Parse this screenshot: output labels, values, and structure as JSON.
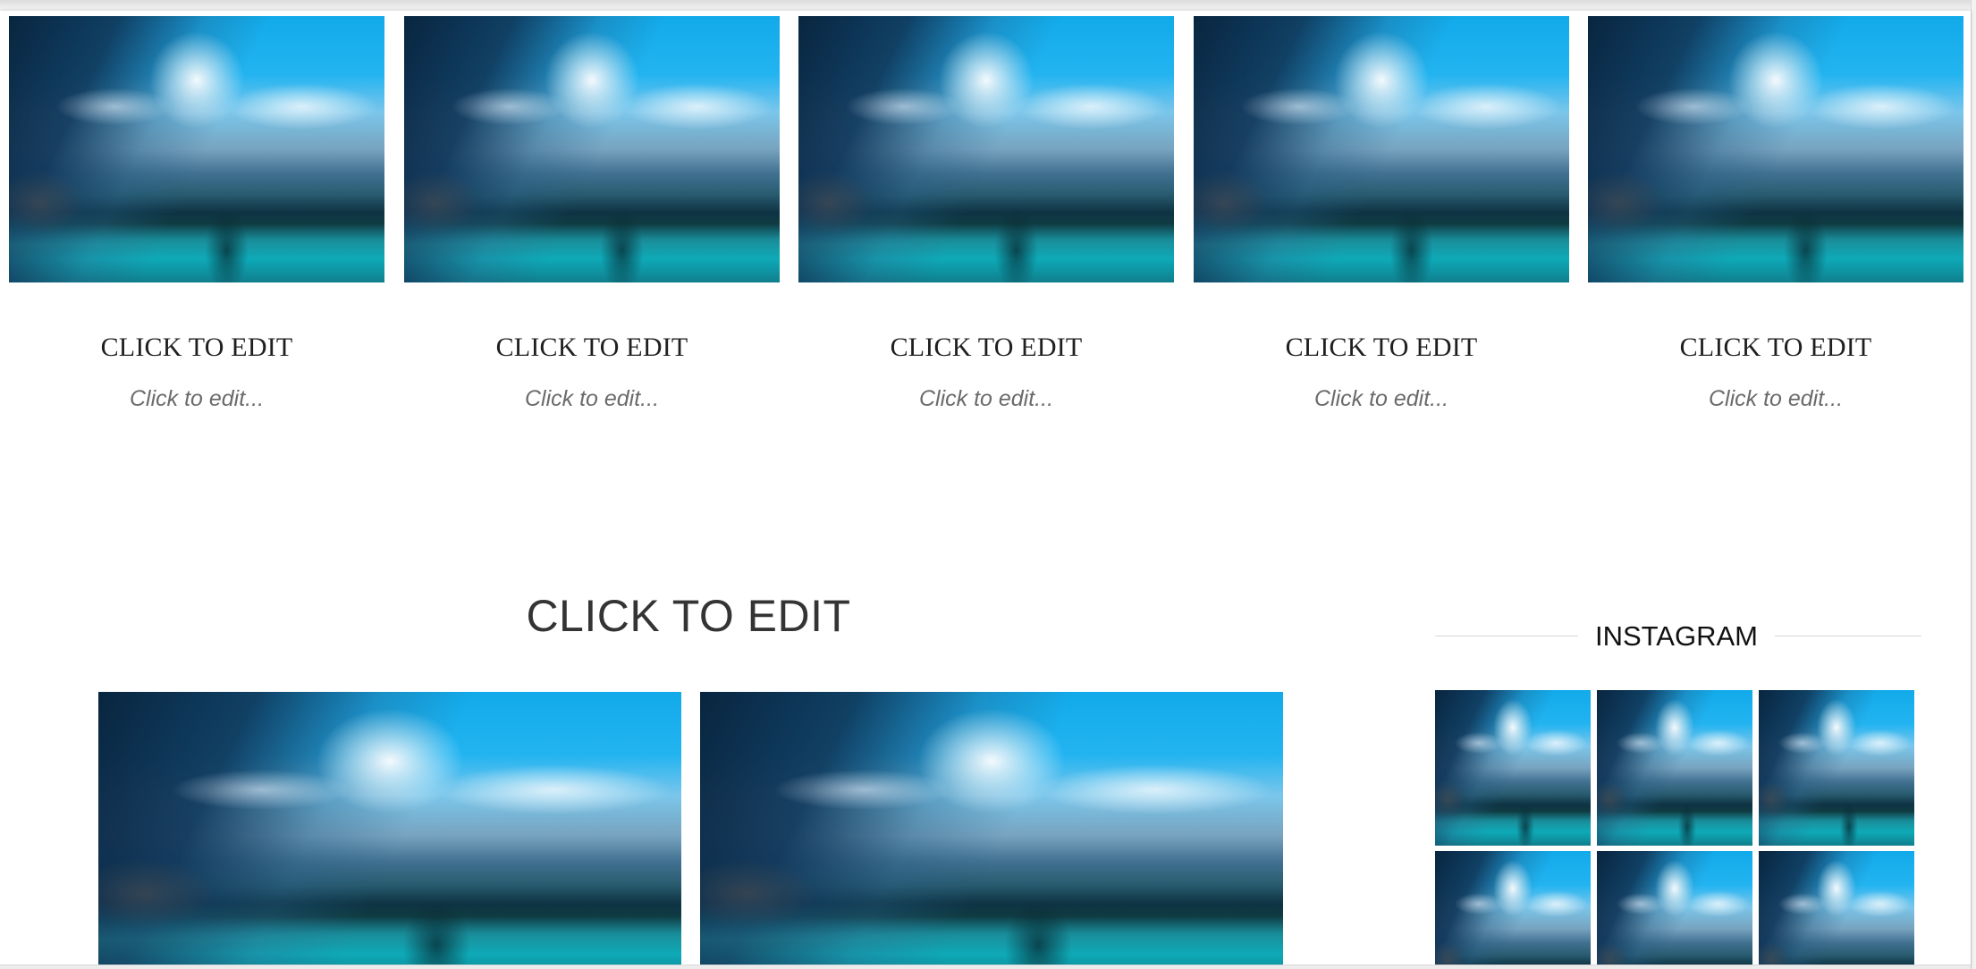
{
  "top_gallery": {
    "cards": [
      {
        "title": "CLICK TO EDIT",
        "subtitle": "Click to edit...",
        "image": "blurred-mountain-lake-photo"
      },
      {
        "title": "CLICK TO EDIT",
        "subtitle": "Click to edit...",
        "image": "blurred-mountain-lake-photo"
      },
      {
        "title": "CLICK TO EDIT",
        "subtitle": "Click to edit...",
        "image": "blurred-mountain-lake-photo"
      },
      {
        "title": "CLICK TO EDIT",
        "subtitle": "Click to edit...",
        "image": "blurred-mountain-lake-photo"
      },
      {
        "title": "CLICK TO EDIT",
        "subtitle": "Click to edit...",
        "image": "blurred-mountain-lake-photo"
      }
    ]
  },
  "main_section": {
    "title": "CLICK TO EDIT",
    "images": [
      "blurred-mountain-lake-photo",
      "blurred-mountain-lake-photo"
    ]
  },
  "instagram": {
    "title": "INSTAGRAM",
    "thumbnails": [
      "blurred-mountain-lake-photo",
      "blurred-mountain-lake-photo",
      "blurred-mountain-lake-photo",
      "blurred-mountain-lake-photo",
      "blurred-mountain-lake-photo",
      "blurred-mountain-lake-photo"
    ]
  },
  "colors": {
    "page_background": "#ffffff",
    "title_text": "#1f1f1f",
    "subtitle_text": "#6b6b6b",
    "divider": "#d7d7d7",
    "sky_blue": "#1ba8e3",
    "lake_teal": "#0fa4b2"
  }
}
